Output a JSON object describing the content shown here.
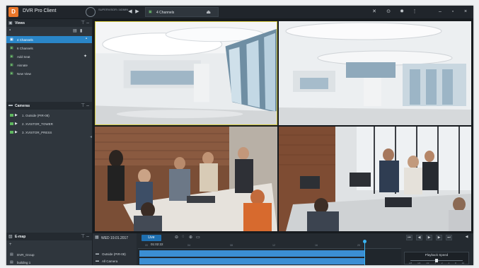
{
  "app": {
    "title": "DVR Pro Client",
    "logo_text": "D"
  },
  "titlebar": {
    "user": "SUPERVISOR / ADMIN",
    "active_tab": "4 Channels",
    "icons": [
      "tools-icon",
      "settings-icon",
      "gear-icon",
      "more-icon",
      "minimize-icon",
      "maximize-icon",
      "close-icon"
    ]
  },
  "views": {
    "title": "Views",
    "items": [
      {
        "label": "4 Channels",
        "selected": true
      },
      {
        "label": "6 Channels",
        "selected": false
      },
      {
        "label": "Add Seat",
        "selected": false
      },
      {
        "label": "Aisnate",
        "selected": false
      },
      {
        "label": "New View",
        "selected": false
      }
    ]
  },
  "cameras": {
    "title": "Cameras",
    "items": [
      {
        "label": "1. Outside (PIR-08)"
      },
      {
        "label": "2. XVISTOR_TOWER"
      },
      {
        "label": "3. XVISTOR_PRESS"
      }
    ]
  },
  "emap": {
    "title": "E-map",
    "items": [
      {
        "label": "DVR_Group"
      },
      {
        "label": "building 1"
      }
    ]
  },
  "timeline": {
    "date": "WED 19.01.2017",
    "live_label": "Live",
    "time": "01:02:22",
    "ticks": [
      "00",
      "04",
      "08",
      "12",
      "16",
      "20"
    ],
    "rows": [
      {
        "label": "Outside (PIR-08)"
      },
      {
        "label": "All Camera"
      }
    ],
    "playback_speed_label": "Playback Speed",
    "speed_ticks": [
      "1/8",
      "1/4",
      "1/2",
      "1",
      "2",
      "4",
      "8",
      "16"
    ]
  }
}
